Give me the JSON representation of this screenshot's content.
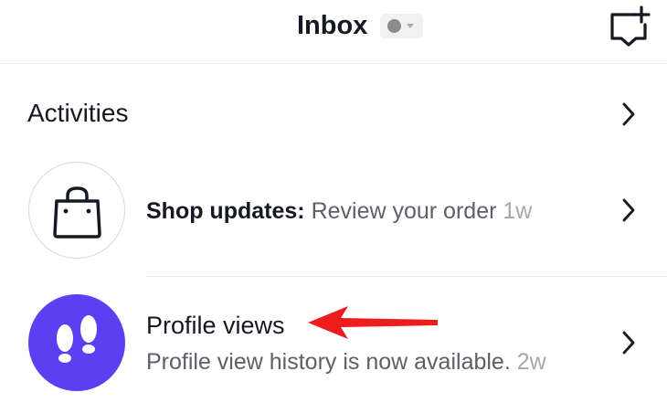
{
  "header": {
    "title": "Inbox",
    "status_icon": "status-dot-icon",
    "new_message_icon": "new-message-icon"
  },
  "activities": {
    "title": "Activities",
    "items": [
      {
        "icon": "shopping-bag-icon",
        "title": "Shop updates:",
        "description": "Review your order",
        "time": "1w"
      },
      {
        "icon": "footprints-icon",
        "title": "Profile views",
        "description": "Profile view history is now available.",
        "time": "2w"
      }
    ]
  },
  "colors": {
    "text": "#161823",
    "secondary": "#5e6068",
    "muted": "#a6a7ab",
    "profile_views_avatar": "#5c3ff0",
    "annotation_arrow": "#ee1d1d"
  },
  "annotation": {
    "icon": "red-arrow-icon"
  }
}
